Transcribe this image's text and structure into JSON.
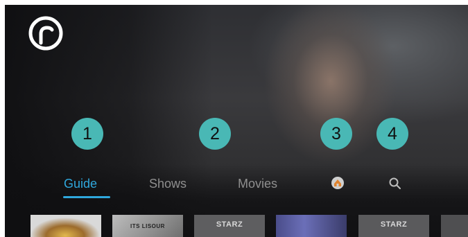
{
  "callouts": [
    "1",
    "2",
    "3",
    "4"
  ],
  "nav": {
    "guide": "Guide",
    "shows": "Shows",
    "movies": "Movies"
  },
  "tiles": [
    {
      "label": ""
    },
    {
      "label": "ITS LISOUR"
    },
    {
      "label": "STARZ"
    },
    {
      "label": ""
    },
    {
      "label": "STARZ"
    },
    {
      "label": ""
    }
  ],
  "icons": {
    "logo": "r-logo",
    "home": "home-icon",
    "search": "search-icon"
  },
  "colors": {
    "accent": "#2fa8dd",
    "callout": "#49b8b5"
  }
}
